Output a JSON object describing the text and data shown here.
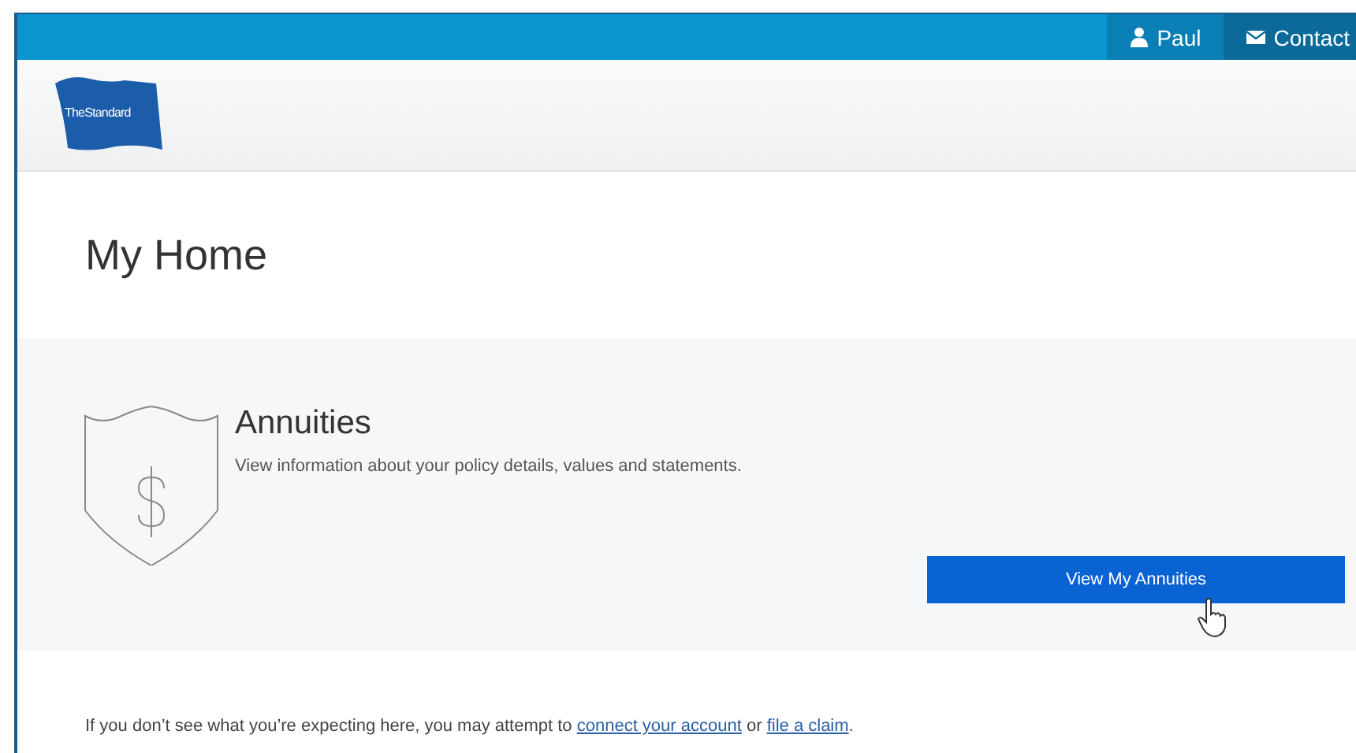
{
  "top_bar": {
    "items": [
      {
        "kind": "user",
        "label": "Paul",
        "selected": false
      },
      {
        "kind": "mail",
        "label": "Contact",
        "selected": true
      }
    ]
  },
  "logo": {
    "text": "TheStandard"
  },
  "page_title": "My Home",
  "card": {
    "title": "Annuities",
    "description": "View information about your policy details, values and statements.",
    "button": "View My Annuities"
  },
  "footer": {
    "parts": [
      {
        "kind": "text",
        "text": "If you don’t see what you’re expecting here, you may attempt to "
      },
      {
        "kind": "link",
        "text": "connect your account"
      },
      {
        "kind": "text",
        "text": " or "
      },
      {
        "kind": "link",
        "text": "file a claim"
      },
      {
        "kind": "text",
        "text": "."
      }
    ]
  }
}
